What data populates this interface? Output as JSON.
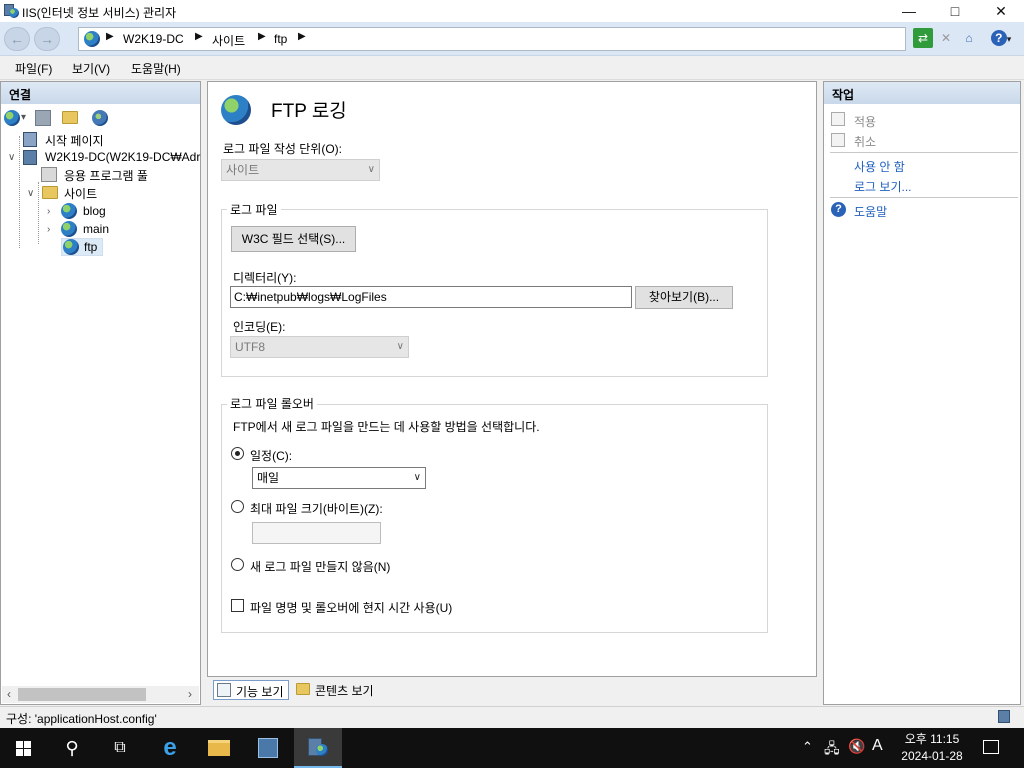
{
  "window": {
    "title": "IIS(인터넷 정보 서비스) 관리자",
    "controls": {
      "minimize": "—",
      "maximize": "□",
      "close": "✕"
    }
  },
  "address": {
    "breadcrumbs": [
      "W2K19-DC",
      "사이트",
      "ftp"
    ]
  },
  "menu": [
    "파일(F)",
    "보기(V)",
    "도움말(H)"
  ],
  "connections": {
    "header": "연결",
    "tree": {
      "start_page": "시작 페이지",
      "server": "W2K19-DC(W2K19-DC₩Adr",
      "app_pools": "응용 프로그램 풀",
      "sites": "사이트",
      "site_items": [
        "blog",
        "main",
        "ftp"
      ]
    }
  },
  "main": {
    "heading": "FTP 로깅",
    "log_file_unit_label": "로그 파일 작성 단위(O):",
    "log_file_unit_value": "사이트",
    "log_file_group": {
      "title": "로그 파일",
      "w3c_button": "W3C 필드 선택(S)...",
      "directory_label": "디렉터리(Y):",
      "directory_value": "C:₩inetpub₩logs₩LogFiles",
      "browse_button": "찾아보기(B)...",
      "encoding_label": "인코딩(E):",
      "encoding_value": "UTF8"
    },
    "rollover_group": {
      "title": "로그 파일 롤오버",
      "description": "FTP에서 새 로그 파일을 만드는 데 사용할 방법을 선택합니다.",
      "schedule_label": "일정(C):",
      "schedule_value": "매일",
      "schedule_checked": true,
      "max_size_label": "최대 파일 크기(바이트)(Z):",
      "max_size_value": "",
      "no_new_label": "새 로그 파일 만들지 않음(N)",
      "local_time_label": "파일 명명 및 롤오버에 현지 시간 사용(U)",
      "local_time_checked": false
    }
  },
  "view_tabs": [
    "기능 보기",
    "콘텐츠 보기"
  ],
  "actions": {
    "header": "작업",
    "apply": "적용",
    "cancel": "취소",
    "disable": "사용 안 함",
    "view_logs": "로그 보기...",
    "help": "도움말"
  },
  "status": {
    "config": "구성: 'applicationHost.config'"
  },
  "taskbar": {
    "time": "오후 11:15",
    "date": "2024-01-28",
    "ime": "A"
  }
}
